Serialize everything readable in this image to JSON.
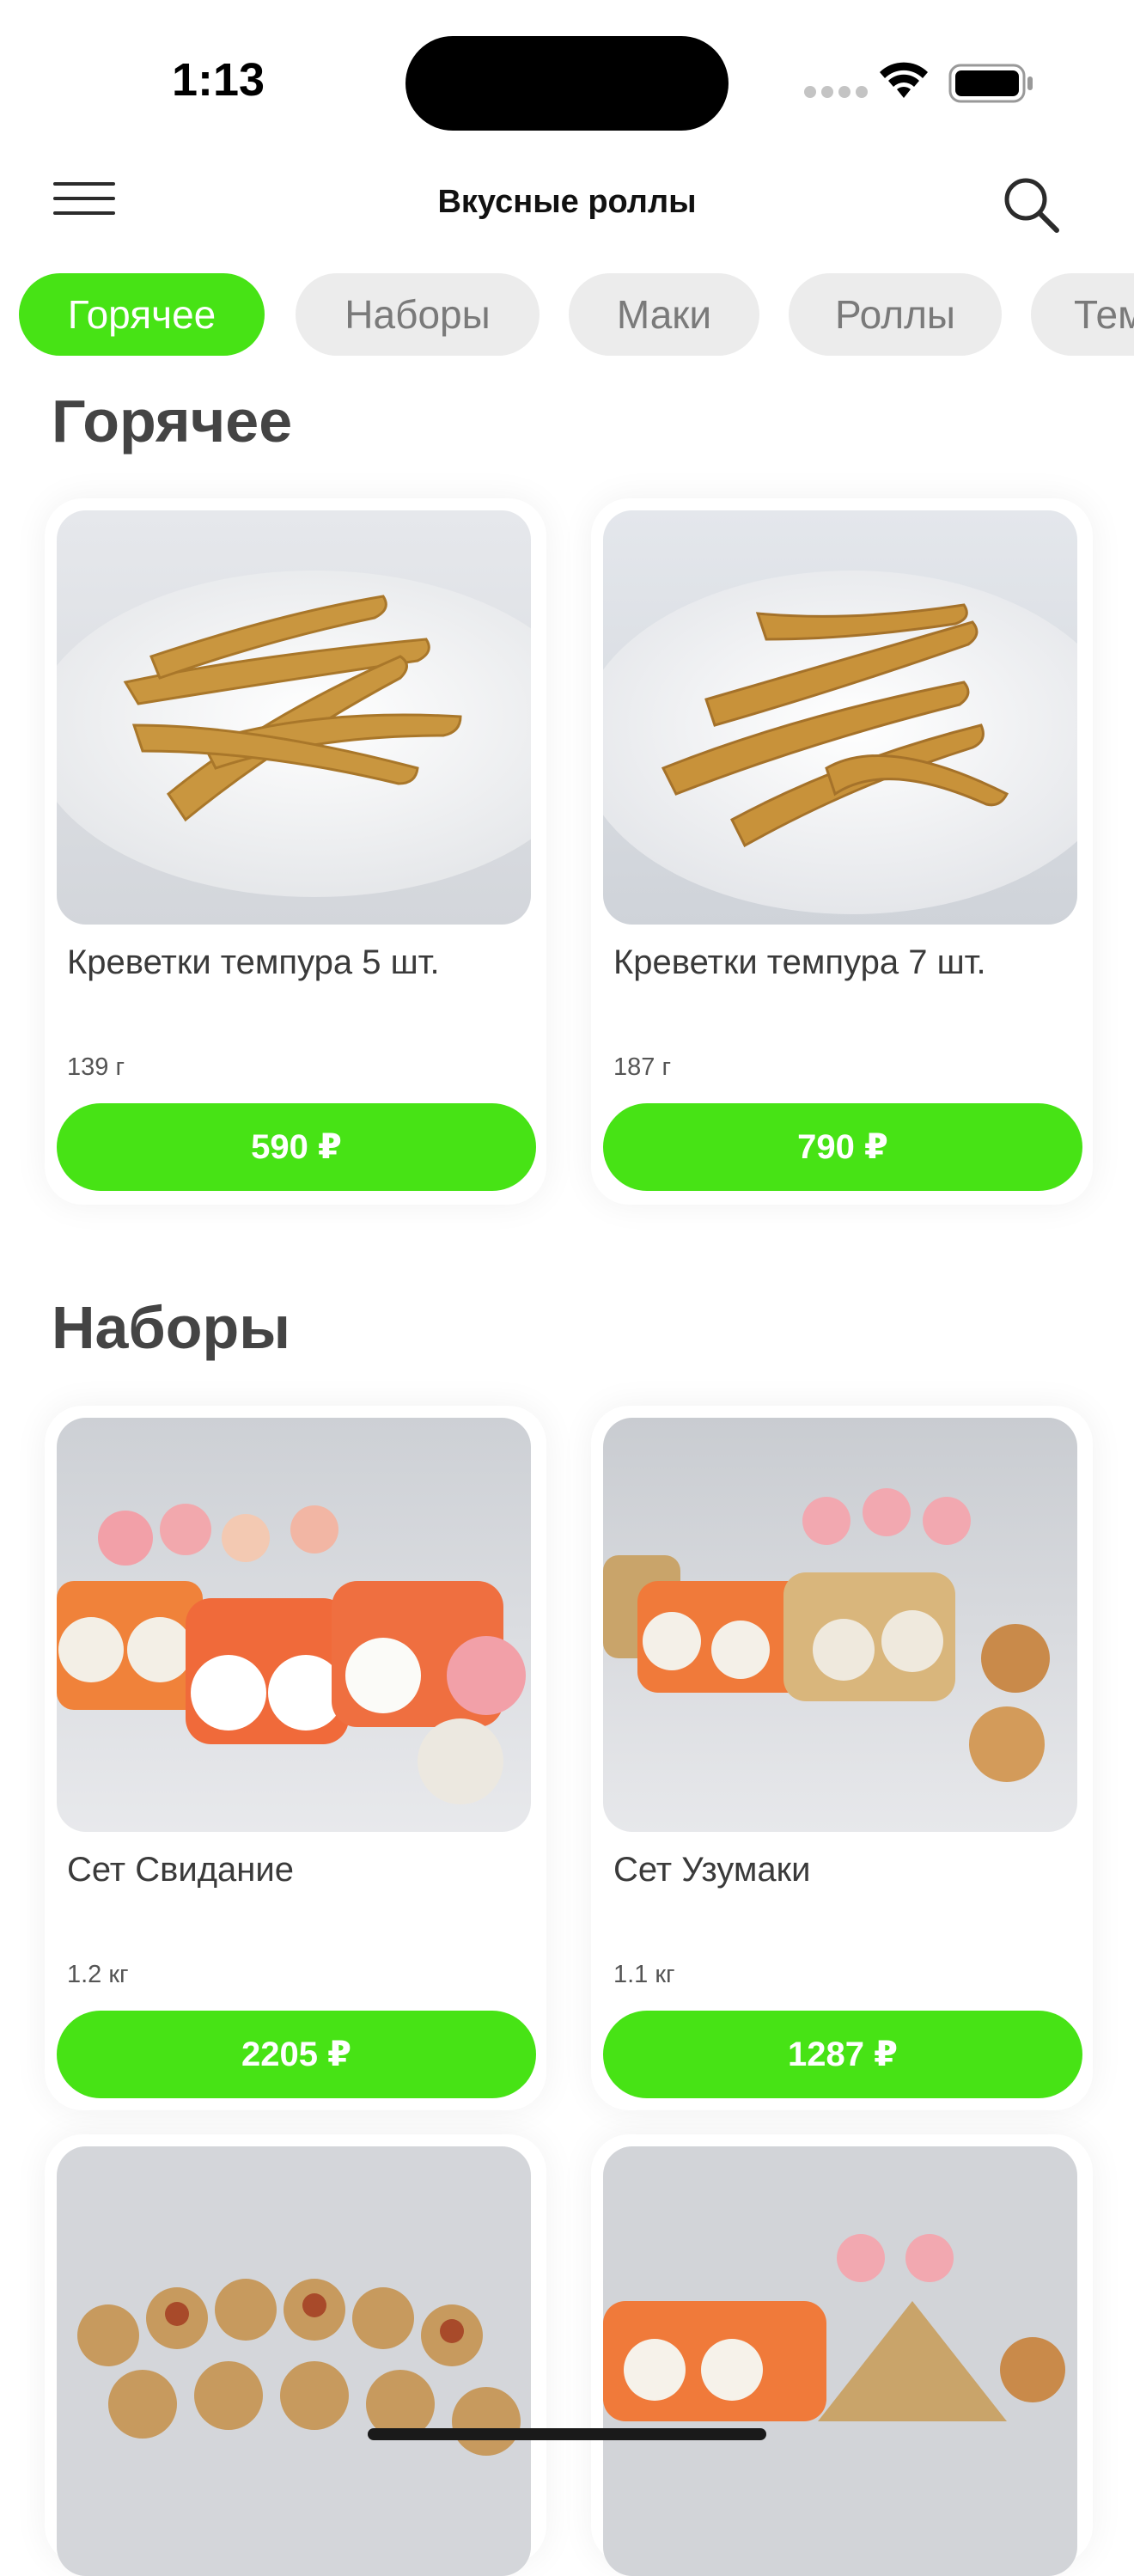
{
  "status": {
    "time": "1:13"
  },
  "header": {
    "title": "Вкусные роллы",
    "menu_icon": "hamburger-menu-icon",
    "search_icon": "search-icon"
  },
  "tabs": [
    {
      "label": "Горячее",
      "active": true
    },
    {
      "label": "Наборы",
      "active": false
    },
    {
      "label": "Маки",
      "active": false
    },
    {
      "label": "Роллы",
      "active": false
    },
    {
      "label": "Тем",
      "active": false
    }
  ],
  "sections": [
    {
      "title": "Горячее",
      "items": [
        {
          "name": "Креветки темпура 5 шт.",
          "weight": "139 г",
          "price": "590 ₽"
        },
        {
          "name": "Креветки темпура 7 шт.",
          "weight": "187 г",
          "price": "790 ₽"
        }
      ]
    },
    {
      "title": "Наборы",
      "items": [
        {
          "name": "Сет Свидание",
          "weight": "1.2 кг",
          "price": "2205 ₽"
        },
        {
          "name": "Сет Узумаки",
          "weight": "1.1 кг",
          "price": "1287 ₽"
        }
      ]
    }
  ],
  "colors": {
    "accent": "#47e315",
    "tab_inactive_bg": "#ececec",
    "tab_inactive_text": "#7a7a7a"
  }
}
